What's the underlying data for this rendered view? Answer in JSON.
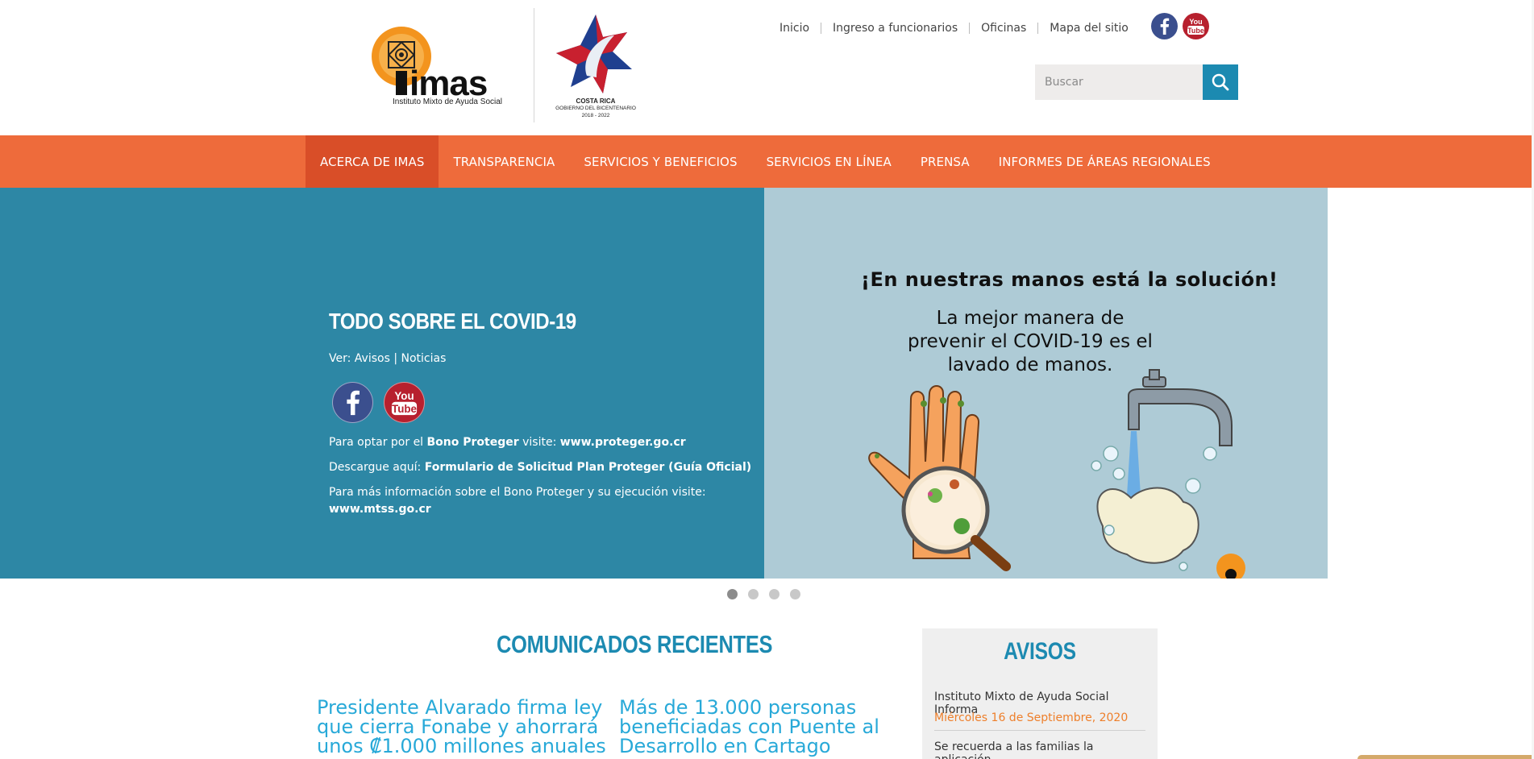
{
  "header": {
    "imas_logo": {
      "wordmark": "imas",
      "subtitle": "Instituto Mixto de Ayuda Social"
    },
    "cr_logo": {
      "line1": "COSTA RICA",
      "line2": "GOBIERNO DEL BICENTENARIO",
      "line3": "2018 - 2022"
    },
    "top_links": [
      "Inicio",
      "Ingreso a funcionarios",
      "Oficinas",
      "Mapa del sitio"
    ],
    "social": {
      "facebook_icon": "facebook-icon",
      "youtube_icon": "youtube-icon",
      "youtube_top": "You",
      "youtube_bottom": "Tube"
    },
    "search": {
      "placeholder": "Buscar",
      "button_icon": "search-icon"
    }
  },
  "nav": {
    "items": [
      "ACERCA DE IMAS",
      "TRANSPARENCIA",
      "SERVICIOS Y BENEFICIOS",
      "SERVICIOS EN LÍNEA",
      "PRENSA",
      "INFORMES DE ÁREAS REGIONALES"
    ],
    "active_index": 0
  },
  "hero": {
    "title": "TODO SOBRE EL COVID-19",
    "ver_prefix": "Ver: ",
    "link_avisos": "Avisos",
    "separator": " | ",
    "link_noticias": "Noticias",
    "p1_prefix": "Para optar por el ",
    "p1_bold": "Bono Proteger",
    "p1_mid": " visite: ",
    "p1_link": "www.proteger.go.cr",
    "p2_prefix": "Descargue aquí: ",
    "p2_link": "Formulario de Solicitud Plan Proteger (Guía Oficial)",
    "p3_text": "Para más información sobre el Bono Proteger y su ejecución visite:",
    "p3_link": "www.mtss.go.cr",
    "image_headline": "¡En nuestras manos está la solución!",
    "image_body": "La mejor manera de prevenir el COVID-19 es el lavado de manos."
  },
  "carousel": {
    "slides": 4,
    "active": 0
  },
  "comunicados": {
    "title": "COMUNICADOS RECIENTES",
    "items": [
      "Presidente Alvarado firma ley que cierra Fonabe y ahorrará unos ₡1.000 millones anuales",
      "Más de 13.000 personas beneficiadas con Puente al Desarrollo en Cartago"
    ]
  },
  "avisos": {
    "title": "AVISOS",
    "items": [
      {
        "title": "Instituto Mixto de Ayuda Social Informa",
        "date": "Miércoles 16 de Septiembre, 2020"
      },
      {
        "title": "Se recuerda a las familias la aplicación"
      }
    ]
  },
  "colors": {
    "brand_orange": "#ee6b3b",
    "active_nav": "#d94e28",
    "brand_blue": "#1c8ab1",
    "hero_blue": "#2d87a5",
    "hero_light": "#aecbd6",
    "date_orange": "#ee7f2b"
  }
}
